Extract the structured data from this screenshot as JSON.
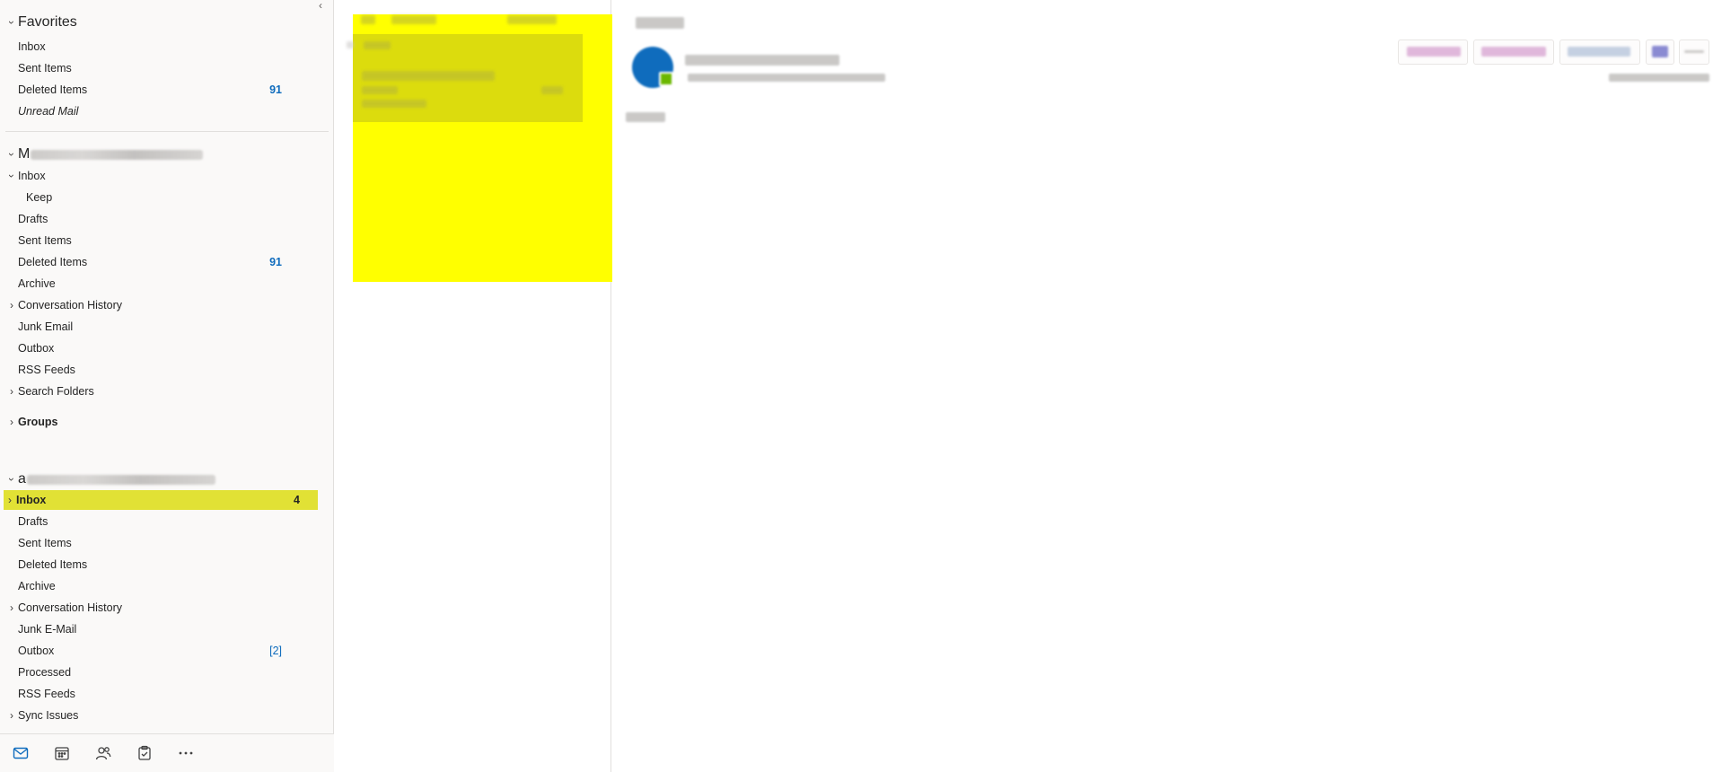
{
  "folder_pane": {
    "favorites": {
      "header": "Favorites",
      "items": [
        {
          "label": "Inbox"
        },
        {
          "label": "Sent Items"
        },
        {
          "label": "Deleted Items",
          "count": "91"
        },
        {
          "label": "Unread Mail"
        }
      ]
    },
    "account1": {
      "header_prefix": "M",
      "folders": [
        {
          "label": "Inbox"
        },
        {
          "label": "Keep"
        },
        {
          "label": "Drafts"
        },
        {
          "label": "Sent Items"
        },
        {
          "label": "Deleted Items",
          "count": "91"
        },
        {
          "label": "Archive"
        },
        {
          "label": "Conversation History"
        },
        {
          "label": "Junk Email"
        },
        {
          "label": "Outbox"
        },
        {
          "label": "RSS Feeds"
        },
        {
          "label": "Search Folders"
        }
      ],
      "groups_label": "Groups"
    },
    "account2": {
      "header_prefix": "a",
      "folders": [
        {
          "label": "Inbox",
          "count": "4"
        },
        {
          "label": "Drafts"
        },
        {
          "label": "Sent Items"
        },
        {
          "label": "Deleted Items"
        },
        {
          "label": "Archive"
        },
        {
          "label": "Conversation History"
        },
        {
          "label": "Junk E-Mail"
        },
        {
          "label": "Outbox",
          "count": "[2]"
        },
        {
          "label": "Processed"
        },
        {
          "label": "RSS Feeds"
        },
        {
          "label": "Sync Issues"
        }
      ]
    }
  },
  "bottom_nav": {
    "items": [
      {
        "icon": "mail-icon"
      },
      {
        "icon": "calendar-icon"
      },
      {
        "icon": "people-icon"
      },
      {
        "icon": "tasks-icon"
      },
      {
        "icon": "more-icon"
      }
    ]
  },
  "colors": {
    "accent": "#0f6cbd",
    "highlight": "#ffff00",
    "selection_highlight": "#e1e135"
  }
}
